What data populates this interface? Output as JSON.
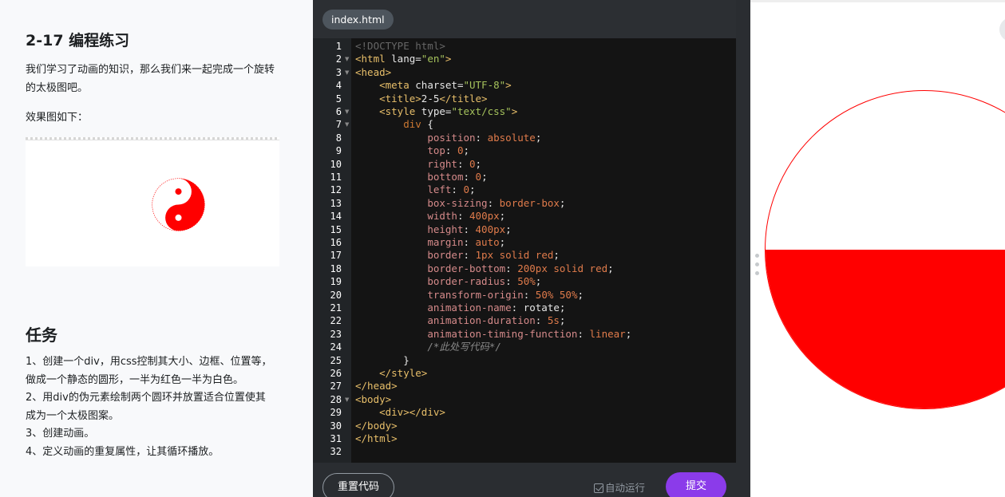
{
  "lesson": {
    "title": "2-17 编程练习",
    "intro": "我们学习了动画的知识，那么我们来一起完成一个旋转的太极图吧。",
    "effect_label": "效果图如下：",
    "task_title": "任务",
    "tasks": [
      "1、创建一个div，用css控制其大小、边框、位置等，做成一个静态的圆形，一半为红色一半为白色。",
      "2、用div的伪元素绘制两个圆环并放置适合位置使其成为一个太极图案。",
      "3、创建动画。",
      "4、定义动画的重复属性，让其循环播放。"
    ]
  },
  "editor": {
    "tab_label": "index.html",
    "line_numbers": [
      "1",
      "2",
      "3",
      "4",
      "5",
      "6",
      "7",
      "8",
      "9",
      "10",
      "11",
      "12",
      "13",
      "14",
      "15",
      "16",
      "17",
      "18",
      "19",
      "20",
      "21",
      "22",
      "23",
      "24",
      "25",
      "26",
      "27",
      "28",
      "29",
      "30",
      "31",
      "32"
    ],
    "reset_label": "重置代码",
    "auto_run_label": "自动运行",
    "submit_label": "提交"
  },
  "colors": {
    "accent": "#8b3bea",
    "red": "#ff0000"
  }
}
